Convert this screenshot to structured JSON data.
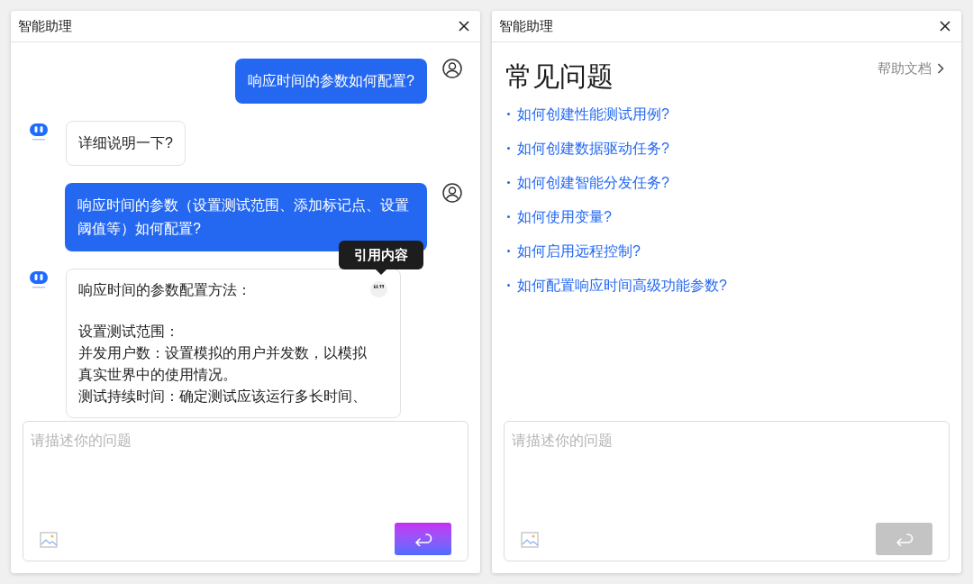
{
  "panels": [
    {
      "title": "智能助理",
      "kind": "chat",
      "messages": [
        {
          "kind": "user",
          "paragraphs": [
            "响应时间的参数如何配置?"
          ]
        },
        {
          "kind": "bot",
          "paragraphs": [
            "详细说明一下?"
          ]
        },
        {
          "kind": "user",
          "paragraphs": [
            "响应时间的参数（设置测试范围、添加标记点、设置阈值等）如何配置?"
          ]
        },
        {
          "kind": "bot",
          "quote": {
            "label": "“”",
            "tooltip": "引用内容"
          },
          "paragraphs": [
            "响应时间的参数配置方法：",
            "设置测试范围：",
            "并发用户数：设置模拟的用户并发数，以模拟真实世界中的使用情况。",
            "测试持续时间：确定测试应该运行多长时间、"
          ]
        }
      ],
      "input": {
        "placeholder": "请描述你的问题"
      },
      "send": {
        "disabled": false
      }
    },
    {
      "title": "智能助理",
      "kind": "faq",
      "heading": "常见问题",
      "help_link": "帮助文档",
      "questions": [
        "如何创建性能测试用例?",
        "如何创建数据驱动任务?",
        "如何创建智能分发任务?",
        "如何使用变量?",
        "如何启用远程控制?",
        "如何配置响应时间高级功能参数?"
      ],
      "input": {
        "placeholder": "请描述你的问题"
      },
      "send": {
        "disabled": true
      }
    }
  ]
}
